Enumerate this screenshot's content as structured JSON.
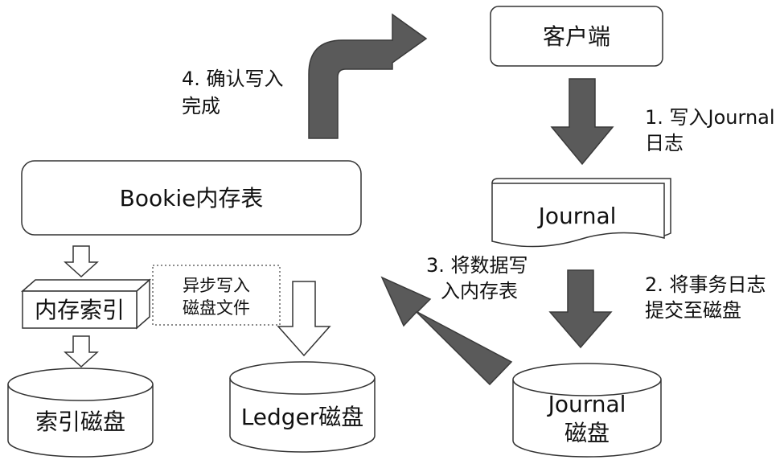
{
  "nodes": {
    "client": "客户端",
    "journal": "Journal",
    "journal_disk_line1": "Journal",
    "journal_disk_line2": "磁盘",
    "bookie_memtable": "Bookie内存表",
    "mem_index": "内存索引",
    "index_disk": "索引磁盘",
    "ledger_disk": "Ledger磁盘"
  },
  "labels": {
    "step1_line1": "1. 写入Journal",
    "step1_line2": "日志",
    "step2_line1": "2. 将事务日志",
    "step2_line2": "提交至磁盘",
    "step3_line1": "3. 将数据写",
    "step3_line2": "入内存表",
    "step4_line1": "4. 确认写入",
    "step4_line2": "完成",
    "async_line1": "异步写入",
    "async_line2": "磁盘文件"
  },
  "colors": {
    "arrow_fill": "#5a5a5a",
    "stroke": "#333333",
    "dotted_border": "#666666"
  }
}
